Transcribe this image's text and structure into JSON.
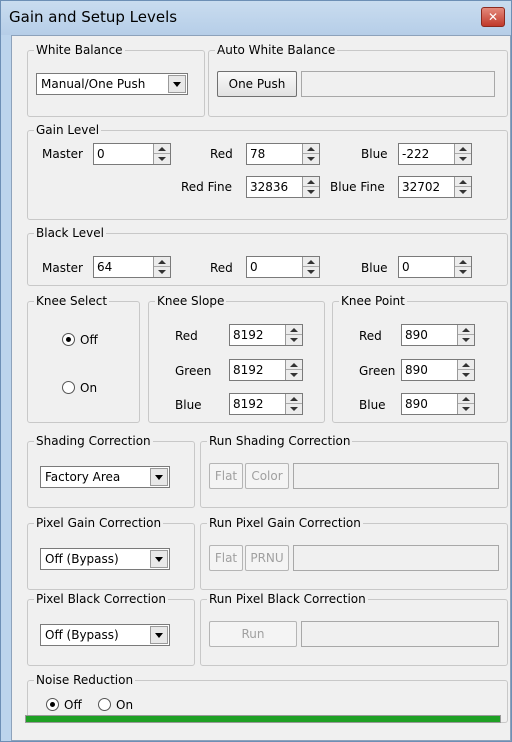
{
  "window": {
    "title": "Gain and Setup Levels",
    "close_icon": "close-icon"
  },
  "white_balance": {
    "legend": "White Balance",
    "value": "Manual/One Push"
  },
  "auto_white_balance": {
    "legend": "Auto White Balance",
    "button": "One Push",
    "status": ""
  },
  "gain_level": {
    "legend": "Gain Level",
    "master_label": "Master",
    "master": "0",
    "red_label": "Red",
    "red": "78",
    "blue_label": "Blue",
    "blue": "-222",
    "red_fine_label": "Red Fine",
    "red_fine": "32836",
    "blue_fine_label": "Blue Fine",
    "blue_fine": "32702"
  },
  "black_level": {
    "legend": "Black Level",
    "master_label": "Master",
    "master": "64",
    "red_label": "Red",
    "red": "0",
    "blue_label": "Blue",
    "blue": "0"
  },
  "knee_select": {
    "legend": "Knee Select",
    "off_label": "Off",
    "on_label": "On",
    "selected": "Off"
  },
  "knee_slope": {
    "legend": "Knee Slope",
    "red_label": "Red",
    "red": "8192",
    "green_label": "Green",
    "green": "8192",
    "blue_label": "Blue",
    "blue": "8192"
  },
  "knee_point": {
    "legend": "Knee Point",
    "red_label": "Red",
    "red": "890",
    "green_label": "Green",
    "green": "890",
    "blue_label": "Blue",
    "blue": "890"
  },
  "shading_correction": {
    "legend": "Shading Correction",
    "value": "Factory Area"
  },
  "run_shading_correction": {
    "legend": "Run Shading Correction",
    "flat": "Flat",
    "color": "Color",
    "status": ""
  },
  "pixel_gain_correction": {
    "legend": "Pixel Gain Correction",
    "value": "Off (Bypass)"
  },
  "run_pixel_gain_correction": {
    "legend": "Run Pixel Gain Correction",
    "flat": "Flat",
    "prnu": "PRNU",
    "status": ""
  },
  "pixel_black_correction": {
    "legend": "Pixel Black Correction",
    "value": "Off (Bypass)"
  },
  "run_pixel_black_correction": {
    "legend": "Run Pixel Black Correction",
    "run": "Run",
    "status": ""
  },
  "noise_reduction": {
    "legend": "Noise Reduction",
    "off_label": "Off",
    "on_label": "On",
    "selected": "Off"
  },
  "progress": {
    "fraction": 1.0,
    "color": "#1ea024"
  },
  "colors": {
    "title_bar": "#bcd4ec",
    "close_button": "#c0392b",
    "dialog_bg": "#f0f0f0"
  }
}
